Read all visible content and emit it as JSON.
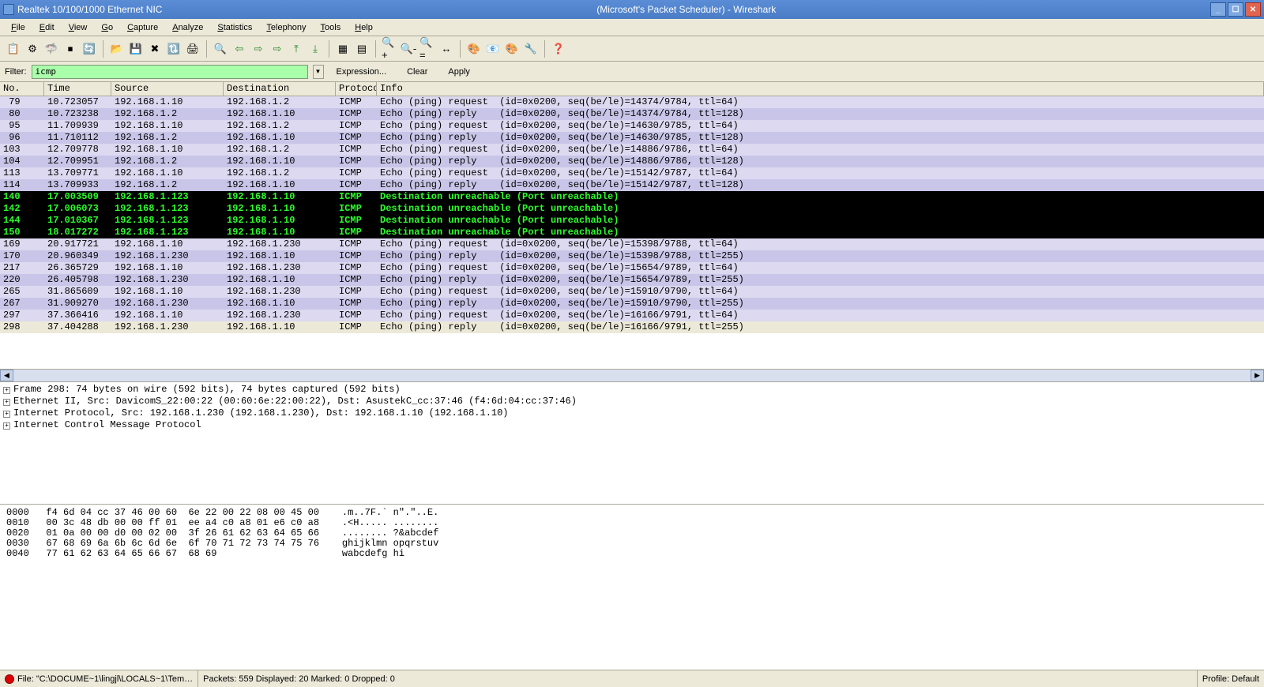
{
  "window": {
    "title_left": "Realtek 10/100/1000 Ethernet NIC",
    "title_center": "(Microsoft's Packet Scheduler)  - Wireshark"
  },
  "menu": [
    "File",
    "Edit",
    "View",
    "Go",
    "Capture",
    "Analyze",
    "Statistics",
    "Telephony",
    "Tools",
    "Help"
  ],
  "filter": {
    "label": "Filter:",
    "value": "icmp",
    "expression": "Expression...",
    "clear": "Clear",
    "apply": "Apply"
  },
  "columns": {
    "no": "No.",
    "time": "Time",
    "src": "Source",
    "dst": "Destination",
    "proto": "Protocol",
    "info": "Info"
  },
  "packets": [
    {
      "no": "79",
      "time": "10.723057",
      "src": "192.168.1.10",
      "dst": "192.168.1.2",
      "proto": "ICMP",
      "info": "Echo (ping) request  (id=0x0200, seq(be/le)=14374/9784, ttl=64)",
      "cls": "row-icmp-even"
    },
    {
      "no": "80",
      "time": "10.723238",
      "src": "192.168.1.2",
      "dst": "192.168.1.10",
      "proto": "ICMP",
      "info": "Echo (ping) reply    (id=0x0200, seq(be/le)=14374/9784, ttl=128)",
      "cls": "row-icmp-odd"
    },
    {
      "no": "95",
      "time": "11.709939",
      "src": "192.168.1.10",
      "dst": "192.168.1.2",
      "proto": "ICMP",
      "info": "Echo (ping) request  (id=0x0200, seq(be/le)=14630/9785, ttl=64)",
      "cls": "row-icmp-even"
    },
    {
      "no": "96",
      "time": "11.710112",
      "src": "192.168.1.2",
      "dst": "192.168.1.10",
      "proto": "ICMP",
      "info": "Echo (ping) reply    (id=0x0200, seq(be/le)=14630/9785, ttl=128)",
      "cls": "row-icmp-odd"
    },
    {
      "no": "103",
      "time": "12.709778",
      "src": "192.168.1.10",
      "dst": "192.168.1.2",
      "proto": "ICMP",
      "info": "Echo (ping) request  (id=0x0200, seq(be/le)=14886/9786, ttl=64)",
      "cls": "row-icmp-even"
    },
    {
      "no": "104",
      "time": "12.709951",
      "src": "192.168.1.2",
      "dst": "192.168.1.10",
      "proto": "ICMP",
      "info": "Echo (ping) reply    (id=0x0200, seq(be/le)=14886/9786, ttl=128)",
      "cls": "row-icmp-odd"
    },
    {
      "no": "113",
      "time": "13.709771",
      "src": "192.168.1.10",
      "dst": "192.168.1.2",
      "proto": "ICMP",
      "info": "Echo (ping) request  (id=0x0200, seq(be/le)=15142/9787, ttl=64)",
      "cls": "row-icmp-even"
    },
    {
      "no": "114",
      "time": "13.709933",
      "src": "192.168.1.2",
      "dst": "192.168.1.10",
      "proto": "ICMP",
      "info": "Echo (ping) reply    (id=0x0200, seq(be/le)=15142/9787, ttl=128)",
      "cls": "row-icmp-odd"
    },
    {
      "no": "140",
      "time": "17.003509",
      "src": "192.168.1.123",
      "dst": "192.168.1.10",
      "proto": "ICMP",
      "info": "Destination unreachable (Port unreachable)",
      "cls": "row-dark"
    },
    {
      "no": "142",
      "time": "17.006073",
      "src": "192.168.1.123",
      "dst": "192.168.1.10",
      "proto": "ICMP",
      "info": "Destination unreachable (Port unreachable)",
      "cls": "row-dark"
    },
    {
      "no": "144",
      "time": "17.010367",
      "src": "192.168.1.123",
      "dst": "192.168.1.10",
      "proto": "ICMP",
      "info": "Destination unreachable (Port unreachable)",
      "cls": "row-dark"
    },
    {
      "no": "150",
      "time": "18.017272",
      "src": "192.168.1.123",
      "dst": "192.168.1.10",
      "proto": "ICMP",
      "info": "Destination unreachable (Port unreachable)",
      "cls": "row-dark"
    },
    {
      "no": "169",
      "time": "20.917721",
      "src": "192.168.1.10",
      "dst": "192.168.1.230",
      "proto": "ICMP",
      "info": "Echo (ping) request  (id=0x0200, seq(be/le)=15398/9788, ttl=64)",
      "cls": "row-icmp-even"
    },
    {
      "no": "170",
      "time": "20.960349",
      "src": "192.168.1.230",
      "dst": "192.168.1.10",
      "proto": "ICMP",
      "info": "Echo (ping) reply    (id=0x0200, seq(be/le)=15398/9788, ttl=255)",
      "cls": "row-icmp-odd"
    },
    {
      "no": "217",
      "time": "26.365729",
      "src": "192.168.1.10",
      "dst": "192.168.1.230",
      "proto": "ICMP",
      "info": "Echo (ping) request  (id=0x0200, seq(be/le)=15654/9789, ttl=64)",
      "cls": "row-icmp-even"
    },
    {
      "no": "220",
      "time": "26.405798",
      "src": "192.168.1.230",
      "dst": "192.168.1.10",
      "proto": "ICMP",
      "info": "Echo (ping) reply    (id=0x0200, seq(be/le)=15654/9789, ttl=255)",
      "cls": "row-icmp-odd"
    },
    {
      "no": "265",
      "time": "31.865609",
      "src": "192.168.1.10",
      "dst": "192.168.1.230",
      "proto": "ICMP",
      "info": "Echo (ping) request  (id=0x0200, seq(be/le)=15910/9790, ttl=64)",
      "cls": "row-icmp-even"
    },
    {
      "no": "267",
      "time": "31.909270",
      "src": "192.168.1.230",
      "dst": "192.168.1.10",
      "proto": "ICMP",
      "info": "Echo (ping) reply    (id=0x0200, seq(be/le)=15910/9790, ttl=255)",
      "cls": "row-icmp-odd"
    },
    {
      "no": "297",
      "time": "37.366416",
      "src": "192.168.1.10",
      "dst": "192.168.1.230",
      "proto": "ICMP",
      "info": "Echo (ping) request  (id=0x0200, seq(be/le)=16166/9791, ttl=64)",
      "cls": "row-icmp-even"
    },
    {
      "no": "298",
      "time": "37.404288",
      "src": "192.168.1.230",
      "dst": "192.168.1.10",
      "proto": "ICMP",
      "info": "Echo (ping) reply    (id=0x0200, seq(be/le)=16166/9791, ttl=255)",
      "cls": "row-sel"
    }
  ],
  "details": [
    "Frame 298: 74 bytes on wire (592 bits), 74 bytes captured (592 bits)",
    "Ethernet II, Src: DavicomS_22:00:22 (00:60:6e:22:00:22), Dst: AsustekC_cc:37:46 (f4:6d:04:cc:37:46)",
    "Internet Protocol, Src: 192.168.1.230 (192.168.1.230), Dst: 192.168.1.10 (192.168.1.10)",
    "Internet Control Message Protocol"
  ],
  "hex": [
    "0000   f4 6d 04 cc 37 46 00 60  6e 22 00 22 08 00 45 00    .m..7F.` n\".\"..E.",
    "0010   00 3c 48 db 00 00 ff 01  ee a4 c0 a8 01 e6 c0 a8    .<H..... ........",
    "0020   01 0a 00 00 d0 00 02 00  3f 26 61 62 63 64 65 66    ........ ?&abcdef",
    "0030   67 68 69 6a 6b 6c 6d 6e  6f 70 71 72 73 74 75 76    ghijklmn opqrstuv",
    "0040   77 61 62 63 64 65 66 67  68 69                      wabcdefg hi"
  ],
  "status": {
    "file": "File: \"C:\\DOCUME~1\\lingjl\\LOCALS~1\\Tem…",
    "packets": "Packets: 559 Displayed: 20 Marked: 0 Dropped: 0",
    "profile": "Profile: Default"
  }
}
